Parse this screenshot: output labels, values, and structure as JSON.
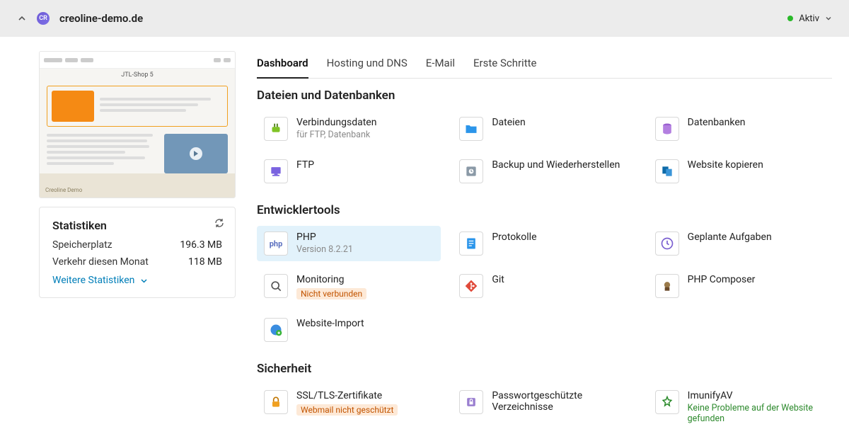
{
  "header": {
    "domain": "creoline-demo.de",
    "favicon_text": "CR",
    "status_label": "Aktiv"
  },
  "sidebar": {
    "screenshot_caption": "Creoline Demo",
    "stats": {
      "title": "Statistiken",
      "rows": [
        {
          "label": "Speicherplatz",
          "value": "196.3 MB"
        },
        {
          "label": "Verkehr diesen Monat",
          "value": "118 MB"
        }
      ],
      "more": "Weitere Statistiken"
    }
  },
  "tabs": [
    "Dashboard",
    "Hosting und DNS",
    "E-Mail",
    "Erste Schritte"
  ],
  "active_tab": 0,
  "sections": [
    {
      "title": "Dateien und Datenbanken",
      "items": [
        {
          "id": "conn",
          "icon": "plug-icon",
          "title": "Verbindungsdaten",
          "sub": "für FTP, Datenbank"
        },
        {
          "id": "files",
          "icon": "folder-icon",
          "title": "Dateien"
        },
        {
          "id": "db",
          "icon": "database-icon",
          "title": "Datenbanken"
        },
        {
          "id": "ftp",
          "icon": "ftp-icon",
          "title": "FTP"
        },
        {
          "id": "backup",
          "icon": "backup-icon",
          "title": "Backup und Wiederherstellen"
        },
        {
          "id": "copy",
          "icon": "copy-icon",
          "title": "Website kopieren"
        }
      ]
    },
    {
      "title": "Entwicklertools",
      "items": [
        {
          "id": "php",
          "icon": "php-icon",
          "title": "PHP",
          "sub": "Version 8.2.21",
          "highlighted": true
        },
        {
          "id": "logs",
          "icon": "log-icon",
          "title": "Protokolle"
        },
        {
          "id": "cron",
          "icon": "clock-icon",
          "title": "Geplante Aufgaben"
        },
        {
          "id": "monitoring",
          "icon": "monitor-icon",
          "title": "Monitoring",
          "badge": "Nicht verbunden"
        },
        {
          "id": "git",
          "icon": "git-icon",
          "title": "Git"
        },
        {
          "id": "composer",
          "icon": "composer-icon",
          "title": "PHP Composer"
        },
        {
          "id": "import",
          "icon": "import-icon",
          "title": "Website-Import"
        }
      ]
    },
    {
      "title": "Sicherheit",
      "items": [
        {
          "id": "ssl",
          "icon": "lock-icon",
          "title": "SSL/TLS-Zertifikate",
          "badge": "Webmail nicht geschützt"
        },
        {
          "id": "pwdir",
          "icon": "shield-icon",
          "title": "Passwortgeschützte Verzeichnisse"
        },
        {
          "id": "imunify",
          "icon": "imunify-icon",
          "title": "ImunifyAV",
          "sub_green": "Keine Probleme auf der Website gefunden"
        }
      ]
    }
  ]
}
